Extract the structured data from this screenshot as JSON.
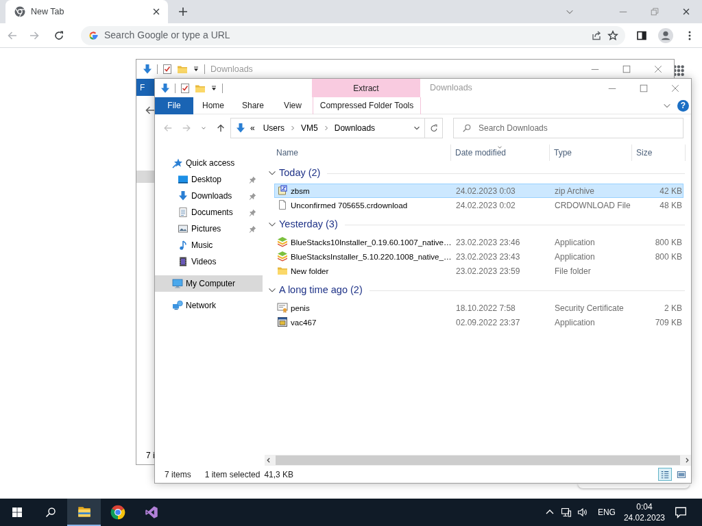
{
  "browser": {
    "tab": {
      "title": "New Tab"
    },
    "omnibox": {
      "placeholder": "Search Google or type a URL"
    }
  },
  "back_window": {
    "title": "Downloads",
    "file_tab": "F",
    "status": "7 i"
  },
  "explorer": {
    "title": "Downloads",
    "context_group": {
      "header": "Extract"
    },
    "ribbon_tabs": [
      {
        "label": "File",
        "kind": "file"
      },
      {
        "label": "Home",
        "kind": "tab"
      },
      {
        "label": "Share",
        "kind": "tab"
      },
      {
        "label": "View",
        "kind": "tab"
      },
      {
        "label": "Compressed Folder Tools",
        "kind": "context"
      }
    ],
    "help": "?",
    "address": {
      "overflow": "«",
      "crumbs": [
        "Users",
        "VM5",
        "Downloads"
      ]
    },
    "search": {
      "placeholder": "Search Downloads"
    },
    "nav": [
      {
        "label": "Quick access",
        "kind": "quick-access",
        "selected": false,
        "children": [
          {
            "label": "Desktop",
            "kind": "desktop",
            "pinned": true,
            "selected": false
          },
          {
            "label": "Downloads",
            "kind": "downloads",
            "pinned": true,
            "selected": false
          },
          {
            "label": "Documents",
            "kind": "documents",
            "pinned": true,
            "selected": false
          },
          {
            "label": "Pictures",
            "kind": "pictures",
            "pinned": true,
            "selected": false
          },
          {
            "label": "Music",
            "kind": "music",
            "pinned": false,
            "selected": false
          },
          {
            "label": "Videos",
            "kind": "videos",
            "pinned": false,
            "selected": false
          }
        ]
      },
      {
        "label": "My Computer",
        "kind": "computer",
        "selected": true
      },
      {
        "label": "Network",
        "kind": "network",
        "selected": false
      }
    ],
    "columns": [
      {
        "label": "Name",
        "sorted": false
      },
      {
        "label": "Date modified",
        "sorted": true
      },
      {
        "label": "Type",
        "sorted": false
      },
      {
        "label": "Size",
        "sorted": false
      }
    ],
    "groups": [
      {
        "title": "Today (2)",
        "expanded": true,
        "rows": [
          {
            "name": "zbsm",
            "kind": "zip",
            "date": "24.02.2023 0:03",
            "type": "zip Archive",
            "size": "42 KB",
            "selected": true
          },
          {
            "name": "Unconfirmed 705655.crdownload",
            "kind": "file",
            "date": "24.02.2023 0:02",
            "type": "CRDOWNLOAD File",
            "size": "48 KB",
            "selected": false
          }
        ]
      },
      {
        "title": "Yesterday (3)",
        "expanded": true,
        "rows": [
          {
            "name": "BlueStacks10Installer_0.19.60.1007_native…",
            "kind": "stack",
            "date": "23.02.2023 23:46",
            "type": "Application",
            "size": "800 KB",
            "selected": false
          },
          {
            "name": "BlueStacksInstaller_5.10.220.1008_native_…",
            "kind": "stack",
            "date": "23.02.2023 23:43",
            "type": "Application",
            "size": "800 KB",
            "selected": false
          },
          {
            "name": "New folder",
            "kind": "folder",
            "date": "23.02.2023 23:59",
            "type": "File folder",
            "size": "",
            "selected": false
          }
        ]
      },
      {
        "title": "A long time ago (2)",
        "expanded": true,
        "rows": [
          {
            "name": "penis",
            "kind": "certificate",
            "date": "18.10.2022 7:58",
            "type": "Security Certificate",
            "size": "2 KB",
            "selected": false
          },
          {
            "name": "vac467",
            "kind": "app",
            "date": "02.09.2022 23:37",
            "type": "Application",
            "size": "709 KB",
            "selected": false
          }
        ]
      }
    ],
    "status": {
      "items": "7 items",
      "selection": "1 item selected",
      "size": "41,3 KB"
    },
    "views": [
      {
        "kind": "details",
        "selected": true
      },
      {
        "kind": "preview",
        "selected": false
      }
    ]
  },
  "taskbar": {
    "apps": [
      {
        "kind": "explorer",
        "active": true
      },
      {
        "kind": "chrome",
        "active": false
      },
      {
        "kind": "visual-studio",
        "active": false
      }
    ],
    "language": "ENG",
    "time": "0:04",
    "date": "24.02.2023"
  }
}
